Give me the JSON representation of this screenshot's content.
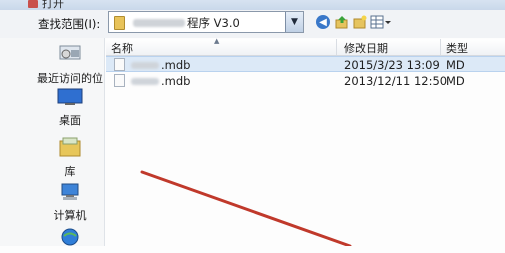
{
  "window": {
    "title": "打开"
  },
  "toolbar": {
    "look_in_label": "查找范围(I):",
    "location_suffix": "程序 V3.0",
    "icons": [
      "back-icon",
      "up-icon",
      "new-folder-icon",
      "views-icon"
    ]
  },
  "sidebar": {
    "items": [
      {
        "label": "最近访问的位置",
        "icon": "recent-places-icon"
      },
      {
        "label": "桌面",
        "icon": "desktop-icon"
      },
      {
        "label": "库",
        "icon": "library-icon"
      },
      {
        "label": "计算机",
        "icon": "computer-icon"
      },
      {
        "label": "",
        "icon": "network-icon"
      }
    ]
  },
  "file_list": {
    "columns": [
      "名称",
      "修改日期",
      "类型"
    ],
    "rows": [
      {
        "name": ".mdb",
        "date": "2015/3/23 13:09",
        "type": "MD",
        "selected": true
      },
      {
        "name": ".mdb",
        "date": "2013/12/11 12:50",
        "type": "MD",
        "selected": false
      }
    ]
  },
  "colors": {
    "selection": "#dce9f7",
    "annotation_line": "#c0392b"
  }
}
